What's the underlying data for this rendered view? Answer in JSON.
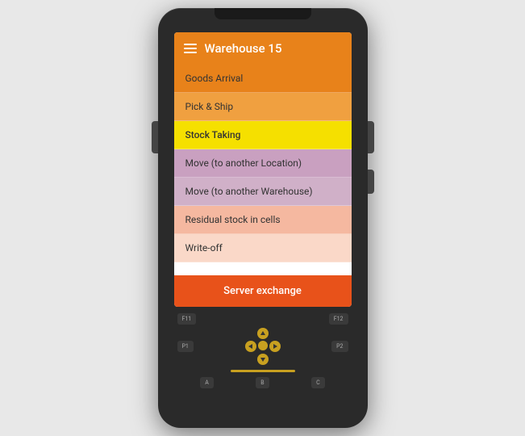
{
  "device": {
    "background": "#2a2a2a"
  },
  "header": {
    "title": "Warehouse 15",
    "menu_icon": "hamburger"
  },
  "menu": {
    "items": [
      {
        "label": "Goods Arrival",
        "bg": "#e8821a"
      },
      {
        "label": "Pick & Ship",
        "bg": "#f0a040"
      },
      {
        "label": "Stock Taking",
        "bg": "#f5e000"
      },
      {
        "label": "Move (to another Location)",
        "bg": "#c9a0c0"
      },
      {
        "label": "Move (to another Warehouse)",
        "bg": "#d0b0c8"
      },
      {
        "label": "Residual stock in cells",
        "bg": "#f5b8a0"
      },
      {
        "label": "Write-off",
        "bg": "#fad8c8"
      }
    ],
    "server_button": "Server exchange"
  },
  "keypad": {
    "fn_keys": [
      "F11",
      "F12"
    ],
    "p_keys": [
      "P1",
      "P2"
    ],
    "nav_keys": [
      "▲",
      "◀",
      "▶",
      "▼"
    ],
    "abc_keys": [
      "A",
      "B",
      "C"
    ]
  }
}
